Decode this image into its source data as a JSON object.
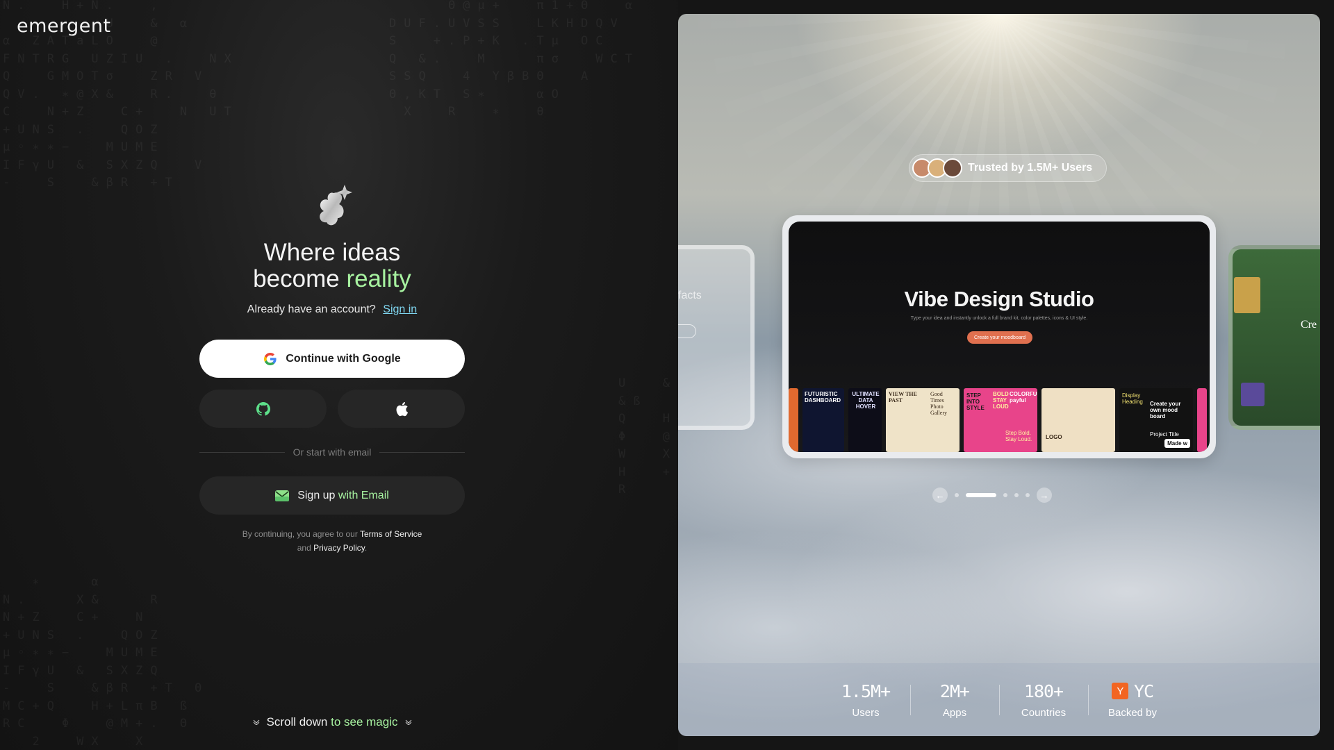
{
  "brand": {
    "logo_text": "emergent"
  },
  "hero": {
    "headline_line1": "Where ideas",
    "headline_line2_prefix": "become",
    "headline_line2_highlight": "reality"
  },
  "account": {
    "prompt": "Already have an account?",
    "signin_label": "Sign in"
  },
  "auth": {
    "google_label": "Continue with Google",
    "github_icon": "github-icon",
    "apple_icon": "apple-icon",
    "divider_label": "Or start with email",
    "email_prefix": "Sign up",
    "email_highlight": "with Email"
  },
  "terms": {
    "prefix": "By continuing, you agree to our",
    "tos_label": "Terms of Service",
    "and": "and",
    "privacy_label": "Privacy Policy"
  },
  "scroll_hint": {
    "prefix": "Scroll down",
    "highlight": "to see magic"
  },
  "showcase": {
    "trusted_label": "Trusted by 1.5M+ Users",
    "left_card_text": "facts",
    "right_card_text": "Cre",
    "main_title": "Vibe Design Studio",
    "main_subtitle": "Type your idea and instantly unlock a full brand kit, color palettes, icons & UI style.",
    "main_button": "Create your moodboard",
    "thumbs": [
      "FUTURISTIC DASHBOARD",
      "ULTIMATE DATA HOVER",
      "VIEW THE PAST",
      "Good Times Photo Gallery",
      "STEP INTO STYLE",
      "BOLD STAY LOUD",
      "COLORFUL payful",
      "Step Bold. Stay Loud.",
      "LOGO",
      "Display Heading",
      "Create your own mood board",
      "Project Title"
    ],
    "made_badge": "Made w",
    "pager": {
      "active_index": 1,
      "count": 6
    }
  },
  "stats": [
    {
      "value": "1.5M+",
      "label": "Users"
    },
    {
      "value": "2M+",
      "label": "Apps"
    },
    {
      "value": "180+",
      "label": "Countries"
    },
    {
      "value": "YC",
      "badge": "Y",
      "label": "Backed by"
    }
  ],
  "colors": {
    "accent_green": "#a7f2a0",
    "link_blue": "#7fd6f0",
    "yc_orange": "#f26522",
    "cta_orange": "#e0704f"
  }
}
